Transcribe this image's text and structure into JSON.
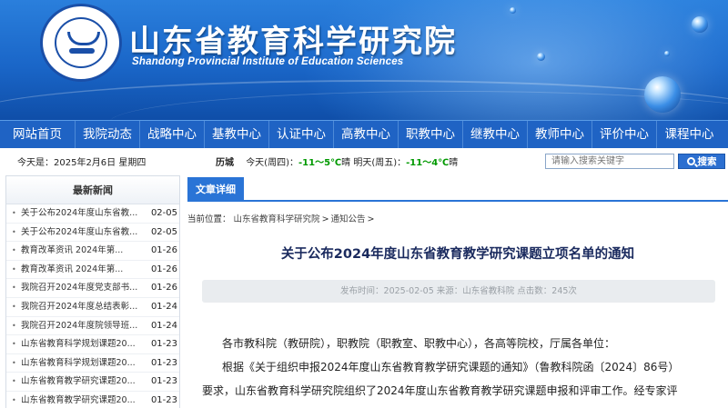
{
  "header": {
    "title": "山东省教育科学研究院",
    "subtitle": "Shandong Provincial Institute of Education Sciences"
  },
  "nav": [
    {
      "label": "网站首页"
    },
    {
      "label": "我院动态"
    },
    {
      "label": "战略中心"
    },
    {
      "label": "基教中心"
    },
    {
      "label": "认证中心"
    },
    {
      "label": "高教中心"
    },
    {
      "label": "职教中心"
    },
    {
      "label": "继教中心"
    },
    {
      "label": "教师中心"
    },
    {
      "label": "评价中心"
    },
    {
      "label": "课程中心"
    }
  ],
  "infobar": {
    "date": "今天是：2025年2月6日 星期四",
    "city": "历城",
    "today_label": "今天(周四)：",
    "today_temp": "-11～5℃",
    "today_weather": "晴",
    "tomorrow_label": "明天(周五)：",
    "tomorrow_temp": "-11～4℃",
    "tomorrow_weather": "晴"
  },
  "search": {
    "placeholder": "请输入搜索关键字",
    "button_label": "搜索"
  },
  "sidebar": {
    "title": "最新新闻",
    "items": [
      {
        "title": "关于公布2024年度山东省教...",
        "date": "02-05"
      },
      {
        "title": "关于公布2024年度山东省教...",
        "date": "02-05"
      },
      {
        "title": "教育改革资讯  2024年第...",
        "date": "01-26"
      },
      {
        "title": "教育改革资讯  2024年第...",
        "date": "01-26"
      },
      {
        "title": "我院召开2024年度党支部书...",
        "date": "01-26"
      },
      {
        "title": "我院召开2024年度总结表彰...",
        "date": "01-24"
      },
      {
        "title": "我院召开2024年度院领导班...",
        "date": "01-24"
      },
      {
        "title": "山东省教育科学规划课题20...",
        "date": "01-23"
      },
      {
        "title": "山东省教育科学规划课题20...",
        "date": "01-23"
      },
      {
        "title": "山东省教育教学研究课题20...",
        "date": "01-23"
      },
      {
        "title": "山东省教育教学研究课题20...",
        "date": "01-23"
      }
    ]
  },
  "main": {
    "tab_label": "文章详细",
    "breadcrumb_prefix": "当前位置：",
    "breadcrumb": [
      "山东省教育科学研究院",
      "通知公告"
    ],
    "title": "关于公布2024年度山东省教育教学研究课题立项名单的通知",
    "meta": "发布时间：2025-02-05 来源：山东省教科院 点击数：245次",
    "paragraphs": [
      "各市教科院（教研院），职教院（职教室、职教中心），各高等院校，厅属各单位：",
      "根据《关于组织申报2024年度山东省教育教学研究课题的通知》（鲁教科院函〔2024〕86号）",
      "要求，山东省教育科学研究院组织了2024年度山东省教育教学研究课题申报和评审工作。经专家评"
    ]
  },
  "colors": {
    "brand_blue": "#1f63c4",
    "accent_blue": "#2a74d6",
    "temp_green": "#009900",
    "temp_red": "#d40000"
  }
}
